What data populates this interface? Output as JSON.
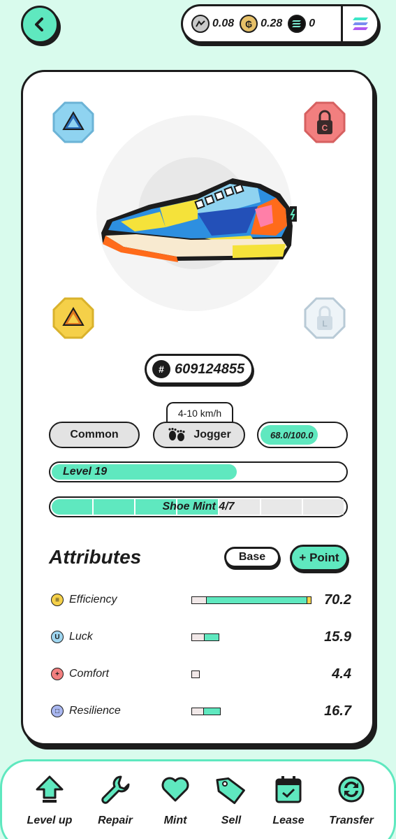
{
  "header": {
    "back_icon": "chevron-left-icon",
    "balances": [
      {
        "name": "GST",
        "icon": "gst-coin-icon",
        "value": "0.08"
      },
      {
        "name": "GMT",
        "icon": "gmt-coin-icon",
        "value": "0.28"
      },
      {
        "name": "SOL",
        "icon": "sol-coin-icon",
        "value": "0"
      }
    ],
    "wallet_icon": "solana-wallet-icon"
  },
  "sneaker": {
    "id": "609124855",
    "speed_range": "4-10 km/h",
    "rarity": "Common",
    "type": "Jogger",
    "durability_text": "68.0/100.0",
    "durability_fraction": 0.68,
    "level_text": "Level 19",
    "level_fraction": 0.63,
    "mint_text": "Shoe Mint 4/7",
    "mint_count": 4,
    "mint_total": 7,
    "gem_slots": [
      {
        "position": "top-left",
        "color": "#8fd3f0",
        "state": "unlocked"
      },
      {
        "position": "top-right",
        "color": "#f27f7f",
        "state": "locked",
        "letter": "C"
      },
      {
        "position": "bottom-left",
        "color": "#f5d049",
        "state": "unlocked"
      },
      {
        "position": "bottom-right",
        "color": "#d8e6ef",
        "state": "locked",
        "letter": "L"
      }
    ]
  },
  "attributes": {
    "title": "Attributes",
    "base_label": "Base",
    "point_label": "+ Point",
    "items": [
      {
        "name": "Efficiency",
        "value": "70.2",
        "icon": "efficiency-icon",
        "icon_color": "#f5d049",
        "glyph": "≡",
        "base_fraction": 0.12,
        "total_fraction": 0.95,
        "maxed": true
      },
      {
        "name": "Luck",
        "value": "15.9",
        "icon": "luck-icon",
        "icon_color": "#9fd6f0",
        "glyph": "U",
        "base_fraction": 0.45,
        "total_fraction": 1.0,
        "maxed": false
      },
      {
        "name": "Comfort",
        "value": "4.4",
        "icon": "comfort-icon",
        "icon_color": "#f27f7f",
        "glyph": "+",
        "base_fraction": 1.0,
        "total_fraction": 1.0,
        "maxed": false
      },
      {
        "name": "Resilience",
        "value": "16.7",
        "icon": "resilience-icon",
        "icon_color": "#a9b7f0",
        "glyph": "□",
        "base_fraction": 0.4,
        "total_fraction": 1.0,
        "maxed": false
      }
    ]
  },
  "nav": [
    {
      "label": "Level up",
      "icon": "level-up-icon"
    },
    {
      "label": "Repair",
      "icon": "wrench-icon"
    },
    {
      "label": "Mint",
      "icon": "heart-icon"
    },
    {
      "label": "Sell",
      "icon": "tag-icon"
    },
    {
      "label": "Lease",
      "icon": "calendar-icon"
    },
    {
      "label": "Transfer",
      "icon": "transfer-icon"
    }
  ]
}
